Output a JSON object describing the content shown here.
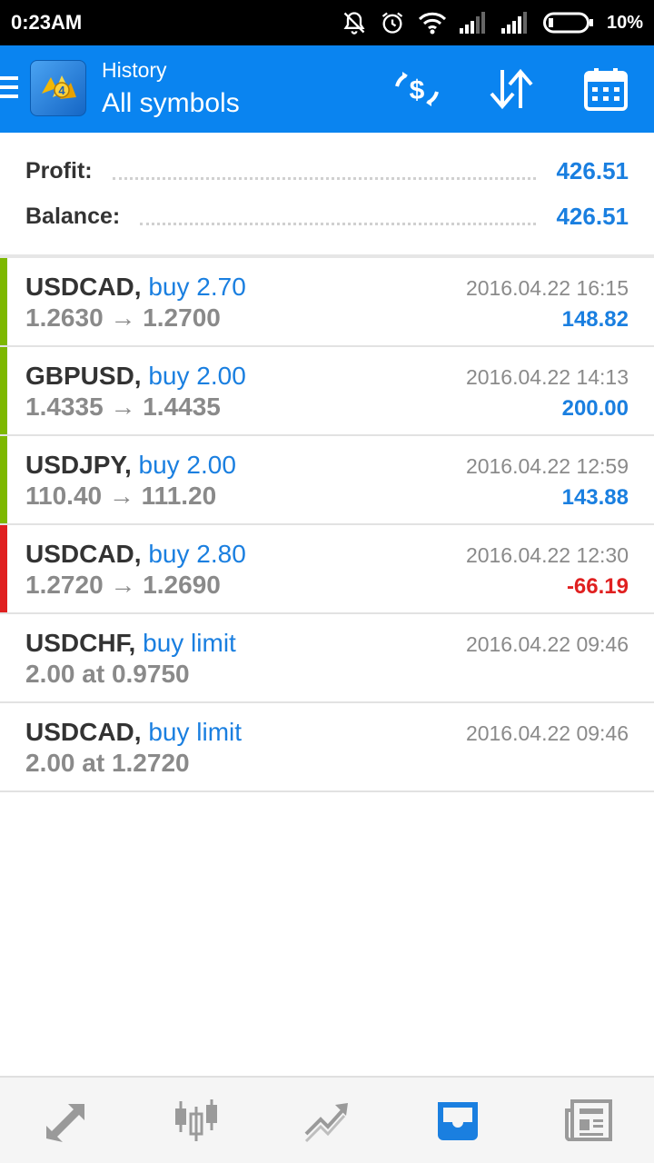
{
  "status_bar": {
    "time": "0:23AM",
    "battery": "10%",
    "icons": [
      "bell-off-icon",
      "alarm-icon",
      "wifi-icon",
      "signal-icon",
      "signal-icon",
      "battery-icon"
    ]
  },
  "app_bar": {
    "title_small": "History",
    "title_large": "All symbols",
    "icons": [
      "menu-icon",
      "app-logo",
      "currency-exchange-icon",
      "sort-icon",
      "calendar-icon"
    ],
    "color": "#0a84f0"
  },
  "summary": {
    "profit_label": "Profit:",
    "profit_value": "426.51",
    "balance_label": "Balance:",
    "balance_value": "426.51"
  },
  "deals": [
    {
      "symbol": "USDCAD,",
      "type": "buy 2.70",
      "prices": "1.2630 → 1.2700",
      "time": "2016.04.22 16:15",
      "profit": "148.82",
      "marker": "#7db800",
      "profit_color": "#1a7fe0"
    },
    {
      "symbol": "GBPUSD,",
      "type": "buy 2.00",
      "prices": "1.4335 → 1.4435",
      "time": "2016.04.22 14:13",
      "profit": "200.00",
      "marker": "#7db800",
      "profit_color": "#1a7fe0"
    },
    {
      "symbol": "USDJPY,",
      "type": "buy 2.00",
      "prices": "110.40 → 111.20",
      "time": "2016.04.22 12:59",
      "profit": "143.88",
      "marker": "#7db800",
      "profit_color": "#1a7fe0"
    },
    {
      "symbol": "USDCAD,",
      "type": "buy 2.80",
      "prices": "1.2720 → 1.2690",
      "time": "2016.04.22 12:30",
      "profit": "-66.19",
      "marker": "#e02020",
      "profit_color": "#e02020"
    },
    {
      "symbol": "USDCHF,",
      "type": "buy limit",
      "prices": "2.00 at 0.9750",
      "time": "2016.04.22 09:46",
      "profit": "",
      "marker": "",
      "profit_color": ""
    },
    {
      "symbol": "USDCAD,",
      "type": "buy limit",
      "prices": "2.00 at 1.2720",
      "time": "2016.04.22 09:46",
      "profit": "",
      "marker": "",
      "profit_color": ""
    }
  ],
  "bottom_nav": {
    "items": [
      {
        "name": "quotes-tab",
        "icon": "trade-arrows-icon",
        "active": false
      },
      {
        "name": "chart-tab",
        "icon": "candlestick-icon",
        "active": false
      },
      {
        "name": "trade-tab",
        "icon": "trend-icon",
        "active": false
      },
      {
        "name": "history-tab",
        "icon": "inbox-icon",
        "active": true
      },
      {
        "name": "news-tab",
        "icon": "newspaper-icon",
        "active": false
      }
    ],
    "active_color": "#1a7fe0",
    "inactive_color": "#9a9a9a"
  }
}
